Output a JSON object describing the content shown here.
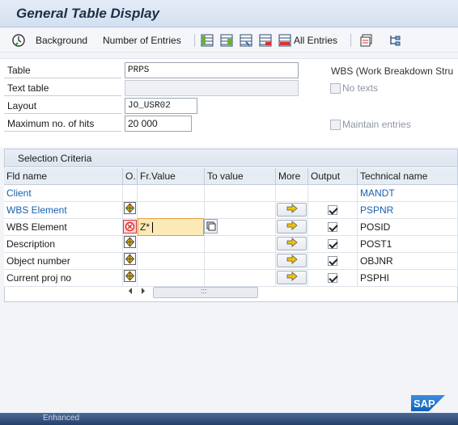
{
  "window": {
    "title": "General Table Display"
  },
  "toolbar": {
    "background_label": "Background",
    "entries_label": "Number of Entries",
    "all_entries_label": "All Entries"
  },
  "form": {
    "table_label": "Table",
    "table_value": "PRPS",
    "table_desc": "WBS (Work Breakdown Stru",
    "text_table_label": "Text table",
    "text_table_value": "",
    "no_texts_label": "No texts",
    "layout_label": "Layout",
    "layout_value": "JO_USR02",
    "max_hits_label": "Maximum no. of hits",
    "max_hits_value": "20 000",
    "maintain_label": "Maintain entries"
  },
  "criteria": {
    "panel_title": "Selection Criteria",
    "columns": [
      "Fld name",
      "O.",
      "Fr.Value",
      "To value",
      "More",
      "Output",
      "Technical name"
    ],
    "rows": [
      {
        "field": "Client",
        "tech": "MANDT",
        "blue": true,
        "has_option": false,
        "has_more": false,
        "output": false
      },
      {
        "field": "WBS Element",
        "tech": "PSPNR",
        "blue": true,
        "has_option": true,
        "has_more": true,
        "output": true
      },
      {
        "field": "WBS Element",
        "tech": "POSID",
        "blue": false,
        "has_option": true,
        "has_more": true,
        "output": true,
        "from_value": "Z*"
      },
      {
        "field": "Description",
        "tech": "POST1",
        "blue": false,
        "has_option": true,
        "has_more": true,
        "output": true
      },
      {
        "field": "Object number",
        "tech": "OBJNR",
        "blue": false,
        "has_option": true,
        "has_more": true,
        "output": true
      },
      {
        "field": "Current proj no",
        "tech": "PSPHI",
        "blue": false,
        "has_option": true,
        "has_more": true,
        "output": true
      }
    ],
    "scroll_grip": ":::"
  },
  "status": {
    "sap_logo": "SAP",
    "bottom_text": "Enhanced"
  },
  "colors": {
    "accent": "#1860b0",
    "edit_bg": "#fbe9b7",
    "title": "#1d2f48"
  },
  "icons": [
    "execute-background-icon",
    "table-icon",
    "multiple-selection-icon",
    "error-icon",
    "f4-help-icon",
    "sap-logo"
  ]
}
